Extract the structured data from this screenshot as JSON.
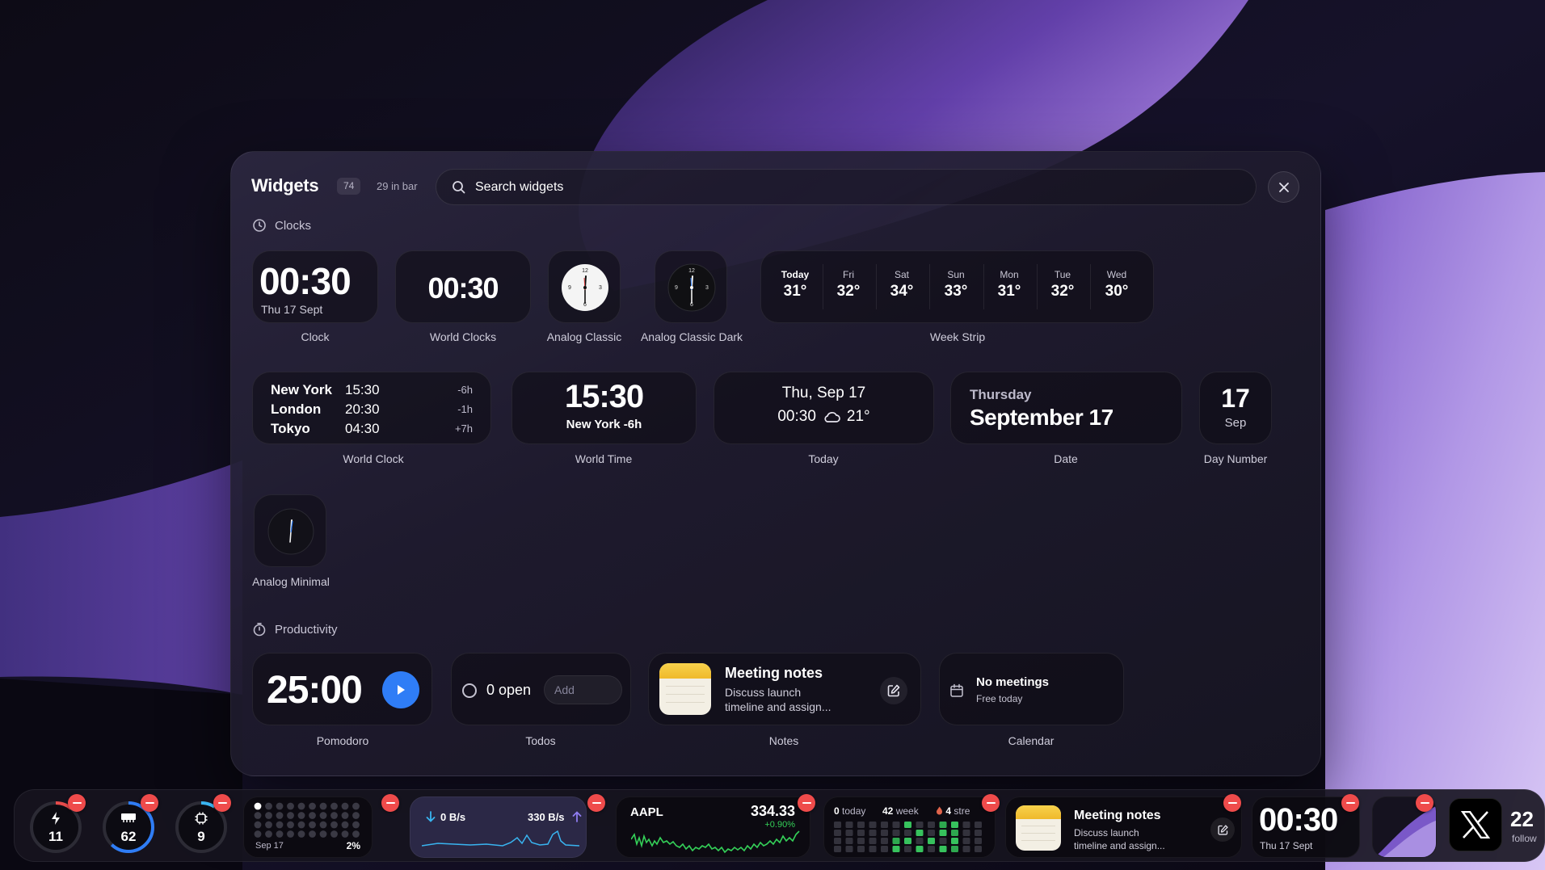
{
  "header": {
    "title": "Widgets",
    "count": "74",
    "in_bar": "29 in bar"
  },
  "search": {
    "placeholder": "Search widgets"
  },
  "sections": {
    "clocks": "Clocks",
    "productivity": "Productivity"
  },
  "clock": {
    "time": "00:30",
    "date": "Thu 17 Sept",
    "label": "Clock"
  },
  "world_clocks": {
    "time": "00:30",
    "label": "World Clocks"
  },
  "analog_classic": {
    "label": "Analog Classic",
    "n12": "12",
    "n3": "3",
    "n6": "6",
    "n9": "9"
  },
  "analog_classic_dark": {
    "label": "Analog Classic Dark",
    "n12": "12",
    "n3": "3",
    "n6": "6",
    "n9": "9"
  },
  "week_strip": {
    "label": "Week Strip",
    "days": [
      {
        "day": "Today",
        "temp": "31°"
      },
      {
        "day": "Fri",
        "temp": "32°"
      },
      {
        "day": "Sat",
        "temp": "34°"
      },
      {
        "day": "Sun",
        "temp": "33°"
      },
      {
        "day": "Mon",
        "temp": "31°"
      },
      {
        "day": "Tue",
        "temp": "32°"
      },
      {
        "day": "Wed",
        "temp": "30°"
      }
    ]
  },
  "world_clock": {
    "label": "World Clock",
    "rows": [
      {
        "city": "New York",
        "time": "15:30",
        "offset": "-6h"
      },
      {
        "city": "London",
        "time": "20:30",
        "offset": "-1h"
      },
      {
        "city": "Tokyo",
        "time": "04:30",
        "offset": "+7h"
      }
    ]
  },
  "world_time": {
    "time": "15:30",
    "sub": "New York -6h",
    "label": "World Time"
  },
  "today": {
    "date": "Thu, Sep 17",
    "time": "00:30",
    "temp": "21°",
    "icon": "cloud-icon",
    "label": "Today"
  },
  "date_widget": {
    "weekday": "Thursday",
    "date": "September 17",
    "label": "Date"
  },
  "day_number": {
    "day": "17",
    "month": "Sep",
    "label": "Day Number"
  },
  "analog_minimal": {
    "label": "Analog Minimal"
  },
  "pomodoro": {
    "time": "25:00",
    "label": "Pomodoro"
  },
  "todos": {
    "count": "0 open",
    "add_placeholder": "Add",
    "label": "Todos"
  },
  "notes": {
    "title": "Meeting notes",
    "line1": "Discuss launch",
    "line2": "timeline and assign...",
    "label": "Notes"
  },
  "calendar": {
    "title": "No meetings",
    "sub": "Free today",
    "label": "Calendar"
  },
  "dock": {
    "battery": {
      "value": "11",
      "icon": "bolt-icon",
      "ring_fraction": 0.11
    },
    "memory": {
      "value": "62",
      "icon": "memory-icon",
      "ring_fraction": 0.62
    },
    "cpu": {
      "value": "9",
      "icon": "chip-icon",
      "ring_fraction": 0.09
    },
    "year_progress": {
      "date": "Sep 17",
      "percent": "2%"
    },
    "network": {
      "down": "0 B/s",
      "up": "330 B/s"
    },
    "stock": {
      "symbol": "AAPL",
      "price": "334.33",
      "change": "+0.90%"
    },
    "habits": {
      "today": "0",
      "today_label": "today",
      "week": "42",
      "week_label": "week",
      "streak": "4",
      "streak_label": "stre"
    },
    "notes": {
      "title": "Meeting notes",
      "line1": "Discuss launch",
      "line2": "timeline and assign..."
    },
    "clock": {
      "time": "00:30",
      "date": "Thu 17 Sept"
    },
    "x_social": {
      "count": "22",
      "label": "follow"
    }
  },
  "colors": {
    "accent_blue": "#2f7df6",
    "remove_red": "#ef4b4b",
    "stock_green": "#34d058",
    "notes_yellow": "#f6c945"
  }
}
